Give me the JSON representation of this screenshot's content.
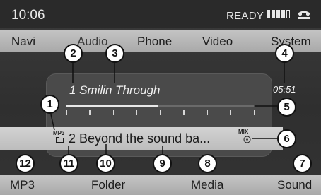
{
  "status": {
    "time": "10:06",
    "ready": "READY",
    "signal_bars_filled": 4,
    "signal_bars_total": 5,
    "icons": [
      "signal-strength-icon",
      "phone-handset-icon"
    ]
  },
  "top_menu": {
    "items": [
      "Navi",
      "Audio",
      "Phone",
      "Video",
      "System"
    ],
    "selected": "Audio"
  },
  "player": {
    "track_title": "1 Smilin Through",
    "elapsed": "05:51",
    "progress": 0.49,
    "format_label": "MP3",
    "selected_track": "2 Beyond the sound ba...",
    "mix_label": "MIX"
  },
  "bottom_menu": {
    "items": [
      "MP3",
      "Folder",
      "",
      "Media",
      "Sound"
    ]
  },
  "callouts": [
    "1",
    "2",
    "3",
    "4",
    "5",
    "6",
    "7",
    "8",
    "9",
    "10",
    "11",
    "12"
  ],
  "colors": {
    "background": "#333333",
    "menu_bar": "#b8b8b8",
    "text_light": "#f0f0f0",
    "text_dark": "#1d1d1d"
  }
}
